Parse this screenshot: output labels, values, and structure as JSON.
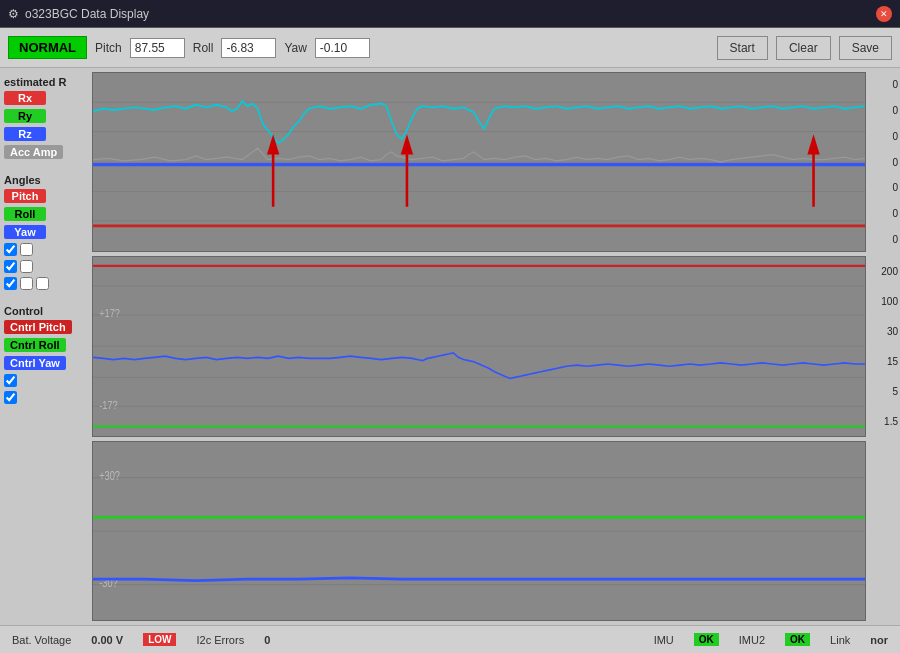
{
  "titlebar": {
    "title": "o323BGC Data Display",
    "icon": "⚙"
  },
  "toolbar": {
    "normal_label": "NORMAL",
    "pitch_label": "Pitch",
    "pitch_value": "87.55",
    "roll_label": "Roll",
    "roll_value": "-6.83",
    "yaw_label": "Yaw",
    "yaw_value": "-0.10",
    "start_label": "Start",
    "clear_label": "Clear",
    "save_label": "Save"
  },
  "panels": {
    "estimated_r": {
      "label": "estimated R",
      "legends": [
        {
          "name": "Rx",
          "color": "red"
        },
        {
          "name": "Ry",
          "color": "green"
        },
        {
          "name": "Rz",
          "color": "blue"
        },
        {
          "name": "Acc Amp",
          "color": "gray"
        }
      ],
      "scale": [
        "0",
        "0",
        "0",
        "0",
        "0",
        "0",
        "0"
      ]
    },
    "angles": {
      "label": "Angles",
      "legends": [
        {
          "name": "Pitch",
          "color": "red"
        },
        {
          "name": "Roll",
          "color": "green"
        },
        {
          "name": "Yaw",
          "color": "blue"
        }
      ],
      "scale": [
        "200",
        "100",
        "30",
        "15",
        "5",
        "1.5"
      ],
      "gridlines": [
        "+17?",
        "-17?"
      ]
    },
    "control": {
      "label": "Control",
      "legends": [
        {
          "name": "Cntrl Pitch",
          "color": "red"
        },
        {
          "name": "Cntrl Roll",
          "color": "green"
        },
        {
          "name": "Cntrl Yaw",
          "color": "blue"
        }
      ],
      "scale": [],
      "gridlines": [
        "+30?",
        "-30?"
      ]
    }
  },
  "statusbar": {
    "bat_voltage_label": "Bat. Voltage",
    "bat_voltage_value": "0.00 V",
    "bat_status": "LOW",
    "i2c_label": "I2c Errors",
    "i2c_value": "0",
    "imu1_label": "IMU",
    "imu1_status": "OK",
    "imu2_label": "IMU2",
    "imu2_status": "OK",
    "link_label": "Link",
    "link_status": "nor"
  }
}
